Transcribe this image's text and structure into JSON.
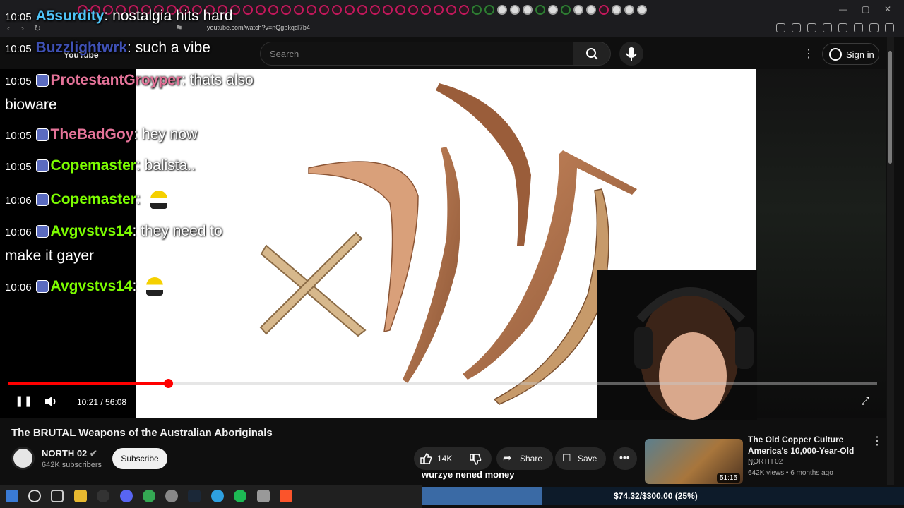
{
  "browser": {
    "url": "youtube.com/watch?v=nQgbkqdl7b4"
  },
  "youtube": {
    "logo_text": "YouTube",
    "search_placeholder": "Search",
    "sign_in": "Sign in"
  },
  "player": {
    "time": "10:21 / 56:08",
    "progress_fraction": 0.184
  },
  "video": {
    "title": "The BRUTAL Weapons of the Australian Aboriginals",
    "channel": "NORTH 02",
    "subscribers": "642K subscribers",
    "subscribe_label": "Subscribe",
    "likes": "14K",
    "share_label": "Share",
    "save_label": "Save"
  },
  "chat": {
    "messages": [
      {
        "time": "10:05",
        "user": "A5surdity",
        "text": "nostalgia hits hard",
        "color": "#4fc3f7"
      },
      {
        "time": "10:05",
        "user": "Buzzlightwrk",
        "text": "such a vibe",
        "color": "#3f51b5"
      },
      {
        "time": "10:05",
        "user": "ProtestantGroyper",
        "text": "thats also",
        "text2": "bioware",
        "color": "#e57399"
      },
      {
        "time": "10:05",
        "user": "TheBadGoy",
        "text": "hey now",
        "color": "#e57399"
      },
      {
        "time": "10:05",
        "user": "Copemaster",
        "text": "balista..",
        "color": "#7cfc00"
      },
      {
        "time": "10:06",
        "user": "Copemaster",
        "text": "",
        "color": "#7cfc00"
      },
      {
        "time": "10:06",
        "user": "Avgvstvs14",
        "text": "they need to",
        "text2": "make it gayer",
        "color": "#7cfc00"
      },
      {
        "time": "10:06",
        "user": "Avgvstvs14",
        "text": "",
        "color": "#7cfc00"
      }
    ]
  },
  "donation": {
    "label": "wurzye nened money",
    "amount": "$74.32/$300.00 (25%)",
    "fraction": 0.25
  },
  "recommended": {
    "title": "The Old Copper Culture America's 10,000-Year-Old ...",
    "channel": "NORTH 02",
    "meta": "642K views • 6 months ago",
    "duration": "51:15"
  }
}
